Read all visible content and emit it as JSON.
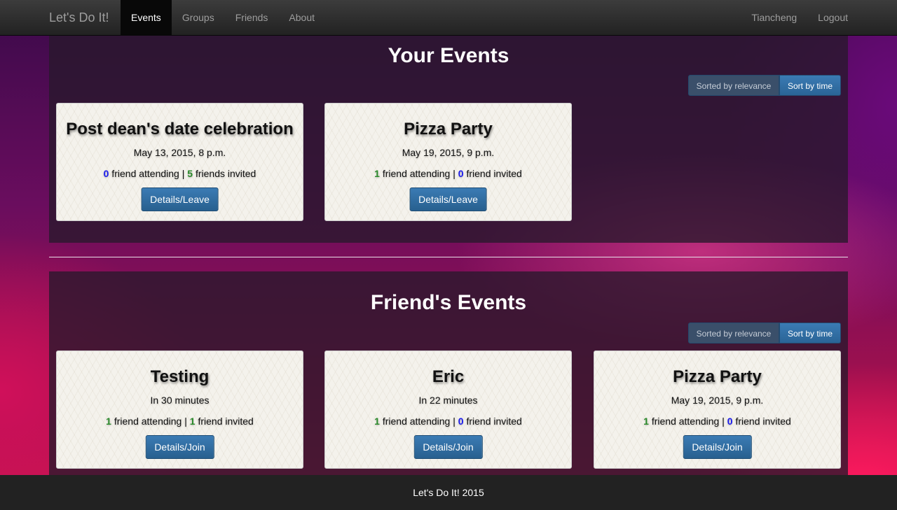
{
  "nav": {
    "brand": "Let's Do It!",
    "items": [
      {
        "label": "Events",
        "active": true
      },
      {
        "label": "Groups"
      },
      {
        "label": "Friends"
      },
      {
        "label": "About"
      }
    ],
    "user": "Tiancheng",
    "logout": "Logout"
  },
  "your_events": {
    "title": "Your Events",
    "sort_relevance": "Sorted by relevance",
    "sort_time": "Sort by time",
    "cards": [
      {
        "title": "Post dean's date celebration",
        "time": "May 13, 2015, 8 p.m.",
        "attending_count": "0",
        "attending_text": "friend attending",
        "separator": "|",
        "invited_count": "5",
        "invited_text": "friends invited",
        "button": "Details/Leave"
      },
      {
        "title": "Pizza Party",
        "time": "May 19, 2015, 9 p.m.",
        "attending_count": "1",
        "attending_text": "friend attending",
        "separator": "|",
        "invited_count": "0",
        "invited_text": "friend invited",
        "button": "Details/Leave"
      }
    ]
  },
  "friend_events": {
    "title": "Friend's Events",
    "sort_relevance": "Sorted by relevance",
    "sort_time": "Sort by time",
    "cards": [
      {
        "title": "Testing",
        "time": "In 30 minutes",
        "attending_count": "1",
        "attending_text": "friend attending",
        "separator": "|",
        "invited_count": "1",
        "invited_text": "friend invited",
        "button": "Details/Join"
      },
      {
        "title": "Eric",
        "time": "In 22 minutes",
        "attending_count": "1",
        "attending_text": "friend attending",
        "separator": "|",
        "invited_count": "0",
        "invited_text": "friend invited",
        "button": "Details/Join"
      },
      {
        "title": "Pizza Party",
        "time": "May 19, 2015, 9 p.m.",
        "attending_count": "1",
        "attending_text": "friend attending",
        "separator": "|",
        "invited_count": "0",
        "invited_text": "friend invited",
        "button": "Details/Join"
      }
    ]
  },
  "footer": {
    "text": "Let's Do It! 2015"
  },
  "colors": {
    "count_positive": "#2a8a2a",
    "count_zero": "#1a1aee",
    "button_primary": "#2a6496"
  }
}
